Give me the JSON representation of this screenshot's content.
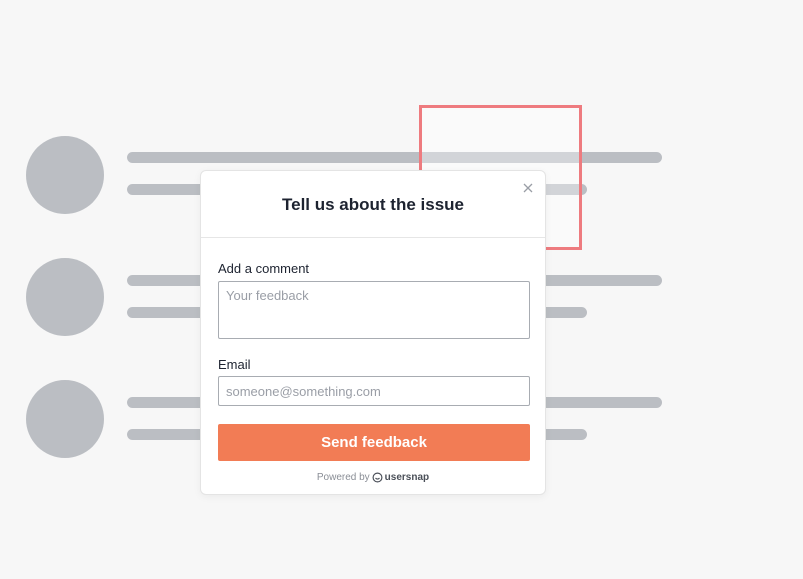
{
  "modal": {
    "title": "Tell us about the issue",
    "close_icon": "close-icon",
    "comment_label": "Add a comment",
    "comment_placeholder": "Your feedback",
    "email_label": "Email",
    "email_placeholder": "someone@something.com",
    "send_label": "Send feedback",
    "powered_by": "Powered by",
    "brand_name": "usersnap"
  },
  "colors": {
    "accent": "#f27c55",
    "highlight": "#ee7b7f",
    "skeleton": "#bbbec3",
    "background": "#f7f7f7"
  }
}
